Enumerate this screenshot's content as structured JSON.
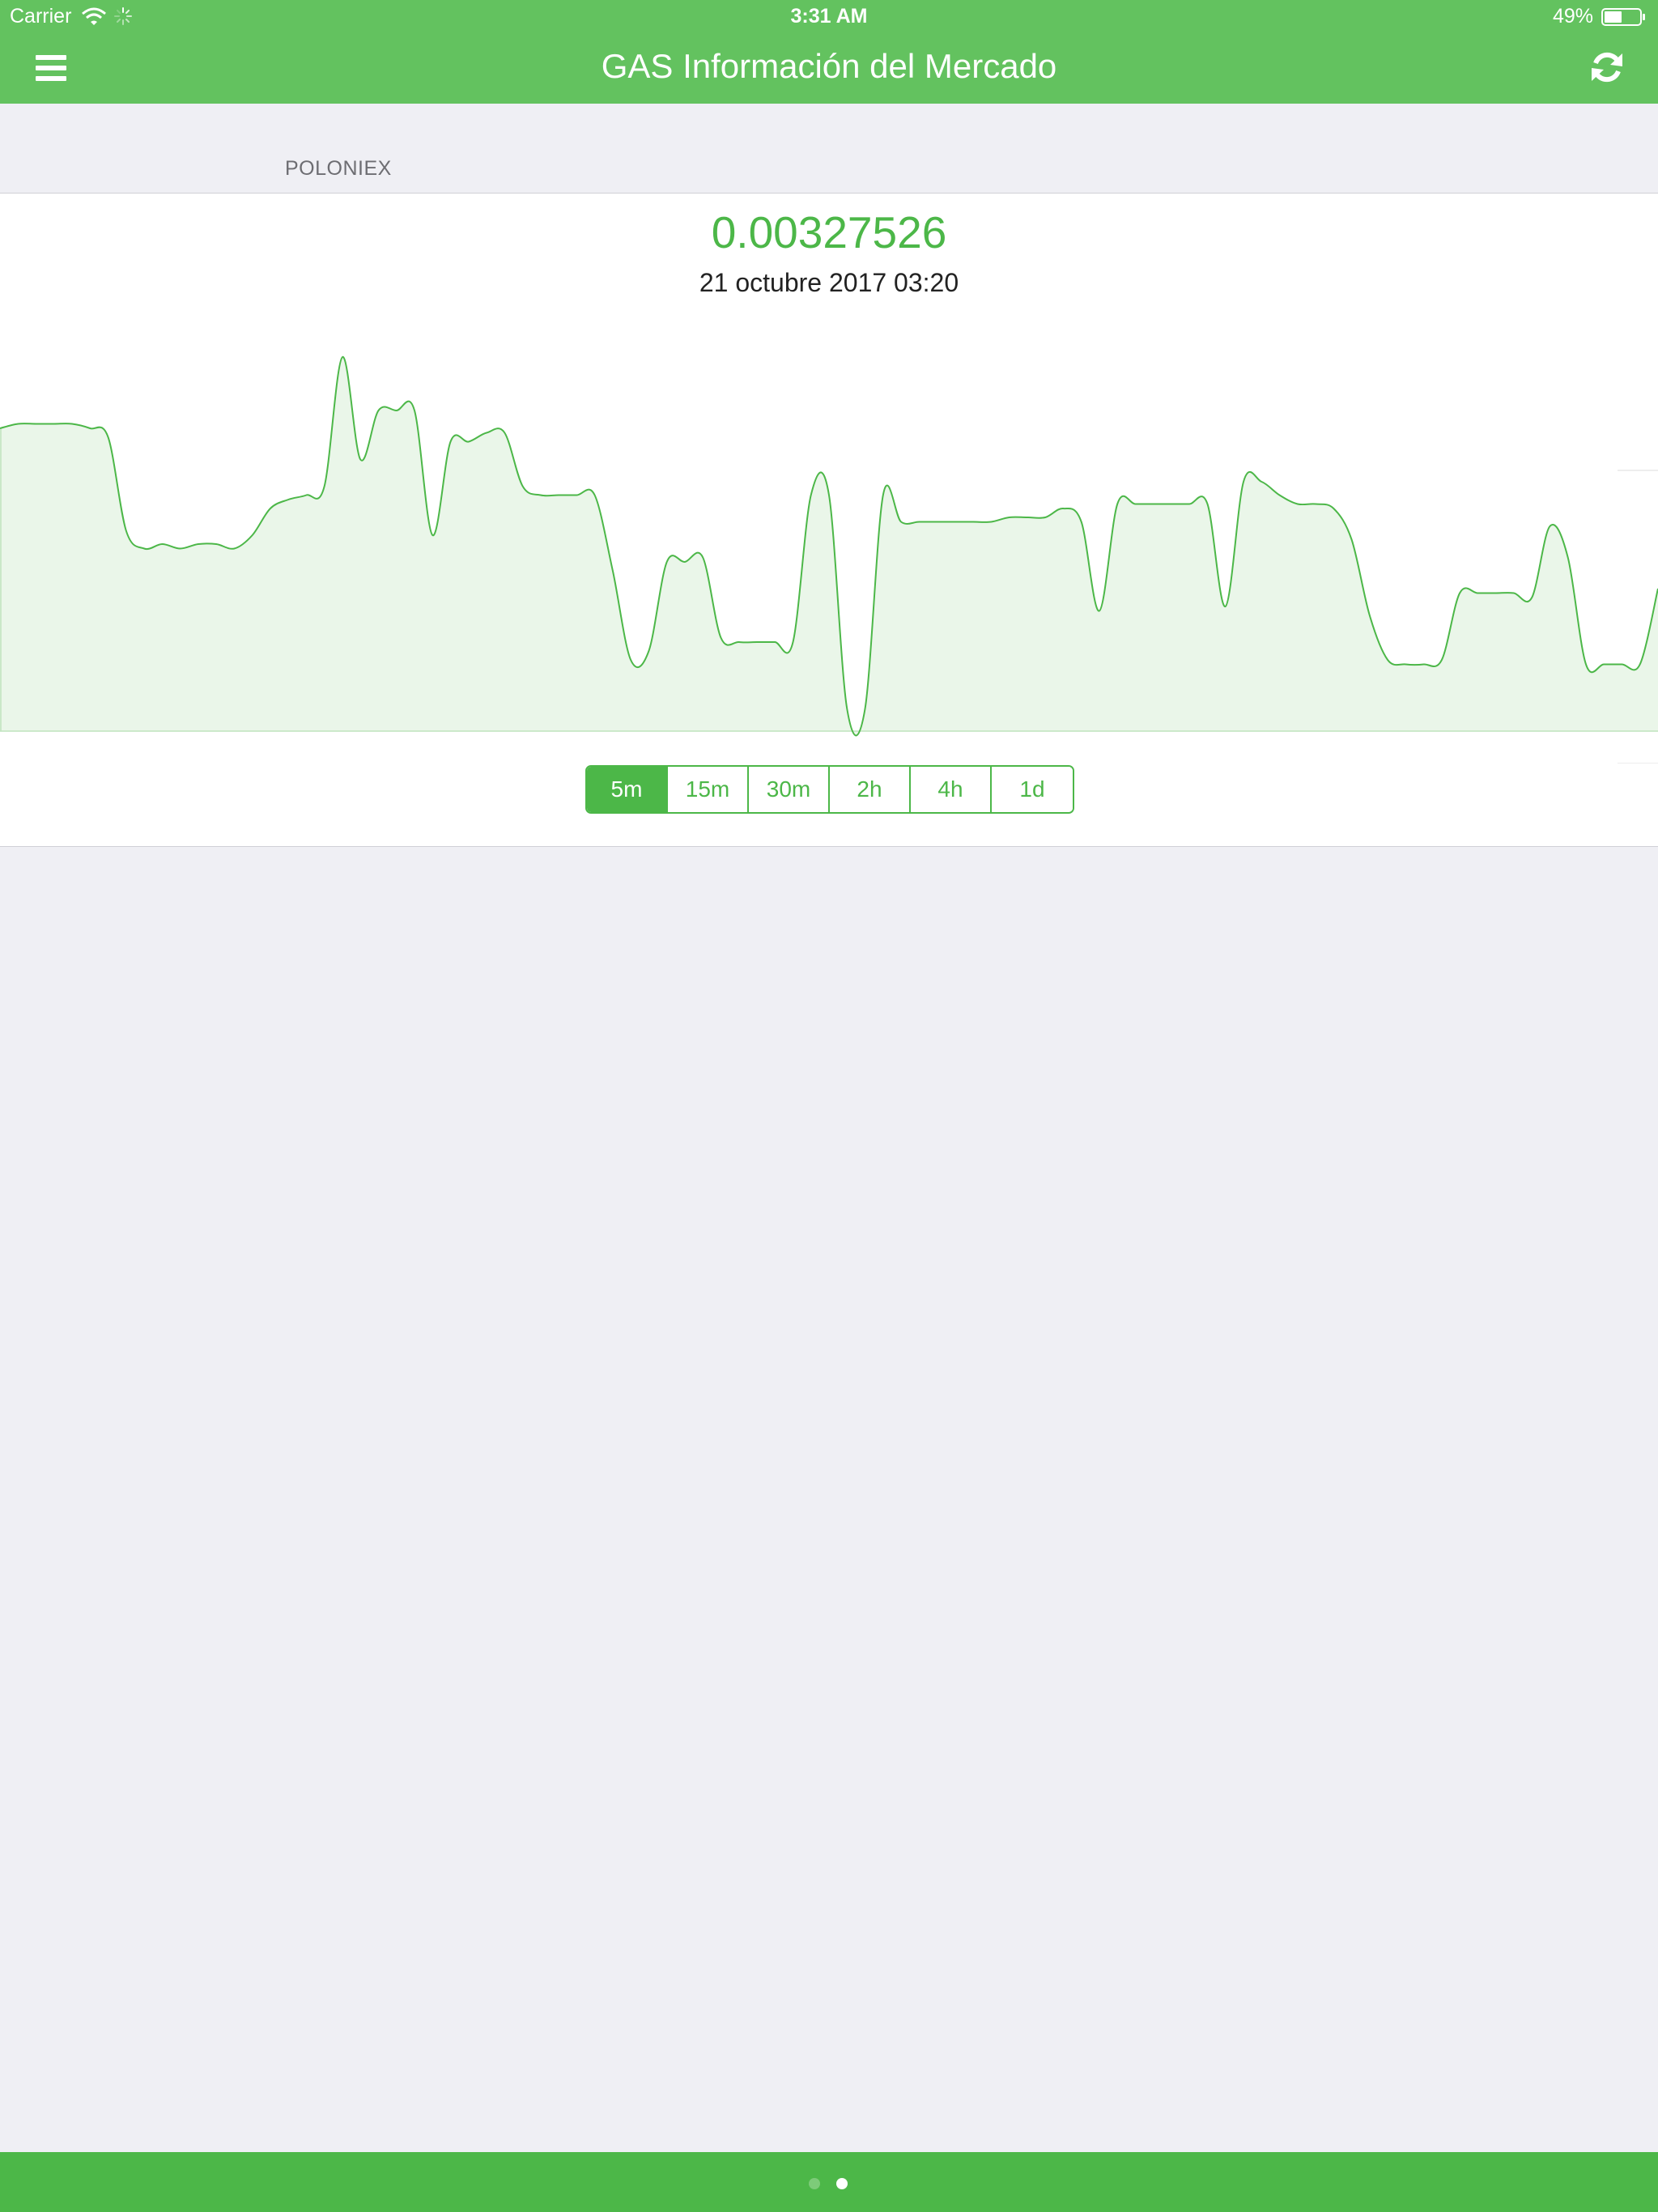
{
  "status_bar": {
    "carrier": "Carrier",
    "time": "3:31 AM",
    "battery": "49%"
  },
  "nav": {
    "title": "GAS Información del Mercado",
    "menu_icon": "hamburger-menu-icon",
    "refresh_icon": "refresh-icon"
  },
  "section": {
    "header": "POLONIEX"
  },
  "market": {
    "price": "0.00327526",
    "timestamp": "21 octubre 2017 03:20"
  },
  "intervals": [
    {
      "label": "5m",
      "selected": true
    },
    {
      "label": "15m",
      "selected": false
    },
    {
      "label": "30m",
      "selected": false
    },
    {
      "label": "2h",
      "selected": false
    },
    {
      "label": "4h",
      "selected": false
    },
    {
      "label": "1d",
      "selected": false
    }
  ],
  "page_control": {
    "pages": 2,
    "current": 2
  },
  "colors": {
    "nav_green": "#63c25f",
    "accent_green": "#4cb748",
    "background": "#efeff4"
  },
  "chart_data": {
    "type": "area",
    "title": "",
    "xlabel": "",
    "ylabel": "",
    "grid": false,
    "ylim": [
      0,
      100
    ],
    "values": [
      68,
      69,
      69,
      69,
      69,
      68,
      66,
      45,
      41,
      42,
      41,
      42,
      42,
      41,
      44,
      50,
      52,
      53,
      55,
      84,
      61,
      72,
      72,
      72,
      44,
      65,
      65,
      67,
      67,
      55,
      53,
      53,
      53,
      53,
      36,
      16,
      18,
      38,
      38,
      39,
      21,
      20,
      20,
      20,
      20,
      53,
      53,
      5,
      5,
      53,
      47,
      47,
      47,
      47,
      47,
      47,
      48,
      48,
      48,
      50,
      47,
      27,
      51,
      51,
      51,
      51,
      51,
      51,
      28,
      56,
      56,
      53,
      51,
      51,
      50,
      43,
      26,
      16,
      15,
      15,
      16,
      31,
      31,
      31,
      31,
      30,
      46,
      39,
      15,
      15,
      15,
      15,
      32
    ]
  }
}
